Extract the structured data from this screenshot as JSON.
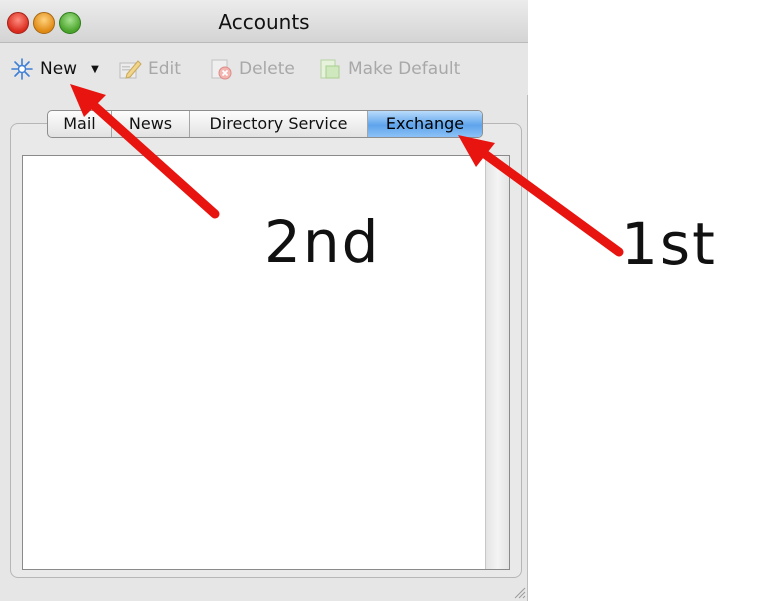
{
  "window": {
    "title": "Accounts"
  },
  "toolbar": {
    "new_label": "New",
    "edit_label": "Edit",
    "delete_label": "Delete",
    "make_default_label": "Make Default"
  },
  "tabs": [
    {
      "label": "Mail",
      "active": false
    },
    {
      "label": "News",
      "active": false
    },
    {
      "label": "Directory Service",
      "active": false
    },
    {
      "label": "Exchange",
      "active": true
    }
  ],
  "accounts_list": [],
  "annotations": {
    "first_label": "1st",
    "second_label": "2nd",
    "arrow_color": "#e8140f"
  },
  "icons": {
    "new": "sparkle-icon",
    "edit": "edit-pencil-icon",
    "delete": "delete-icon",
    "make_default": "make-default-icon"
  }
}
